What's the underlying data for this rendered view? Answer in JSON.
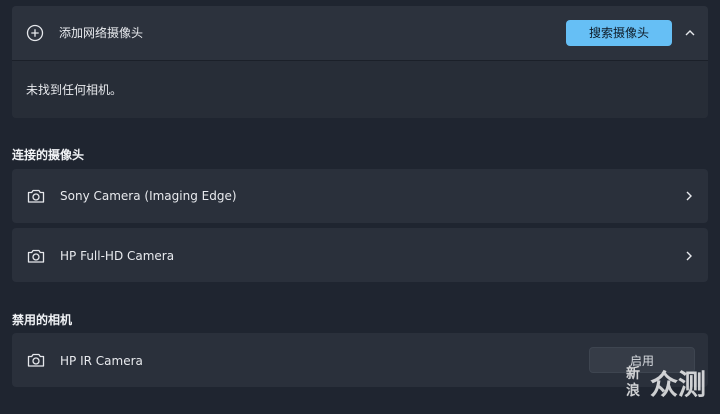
{
  "add_network_camera": {
    "label": "添加网络摄像头",
    "search_button": "搜索摄像头",
    "status_message": "未找到任何相机。"
  },
  "connected_section": {
    "title": "连接的摄像头",
    "cameras": [
      {
        "name": "Sony Camera (Imaging Edge)"
      },
      {
        "name": "HP Full-HD Camera"
      }
    ]
  },
  "disabled_section": {
    "title": "禁用的相机",
    "cameras": [
      {
        "name": "HP IR Camera",
        "action": "启用"
      }
    ]
  },
  "watermark": {
    "small_text": "新浪",
    "large_text": "众测"
  },
  "colors": {
    "accent": "#66bff5",
    "background": "#1f2530",
    "card": "#2a303b"
  }
}
